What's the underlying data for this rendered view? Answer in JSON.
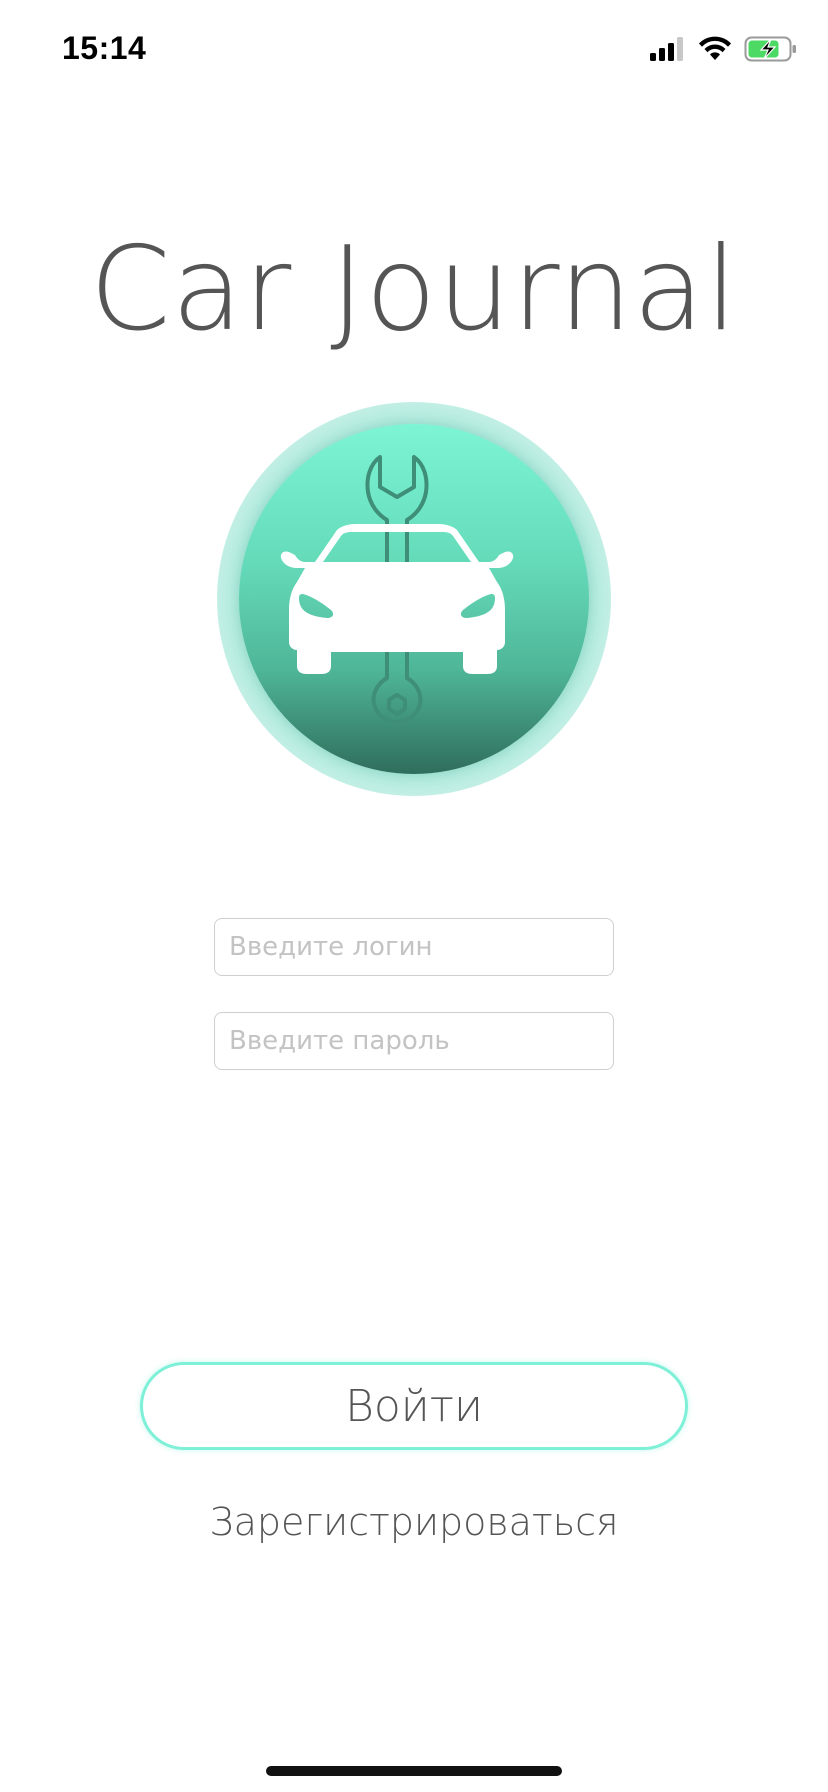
{
  "status_bar": {
    "time": "15:14",
    "icons": [
      "cellular-signal-icon",
      "wifi-icon",
      "battery-charging-icon"
    ],
    "battery_color": "#4cd964"
  },
  "app": {
    "title": "Car Journal",
    "logo_icon": "car-wrench-icon",
    "accent_color": "#7ef0d8"
  },
  "form": {
    "login_placeholder": "Введите логин",
    "login_value": "",
    "password_placeholder": "Введите пароль",
    "password_value": ""
  },
  "actions": {
    "login_label": "Войти",
    "register_label": "Зарегистрироваться"
  }
}
